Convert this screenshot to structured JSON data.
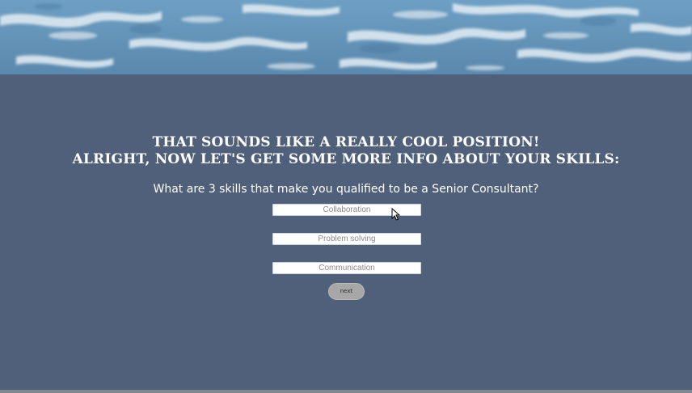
{
  "banner": {
    "image": "ocean-water-texture",
    "colors": {
      "deep": "#5d8fb6",
      "mid": "#86b1cf",
      "foam": "#e8f1f7"
    }
  },
  "headline": {
    "line1": "THAT SOUNDS LIKE A REALLY COOL POSITION!",
    "line2": "ALRIGHT, NOW LET'S GET SOME MORE INFO ABOUT YOUR SKILLS:"
  },
  "question": "What are 3 skills that make you qualified to be a Senior Consultant?",
  "skills": {
    "skill1": {
      "placeholder": "Collaboration",
      "value": ""
    },
    "skill2": {
      "placeholder": "Problem solving",
      "value": ""
    },
    "skill3": {
      "placeholder": "Communication",
      "value": ""
    }
  },
  "next_button": {
    "label": "next"
  },
  "theme": {
    "background": "#50607b",
    "text": "#ffffff",
    "button": "#a7a7a7"
  },
  "cursor": {
    "icon": "mouse-pointer-icon"
  }
}
